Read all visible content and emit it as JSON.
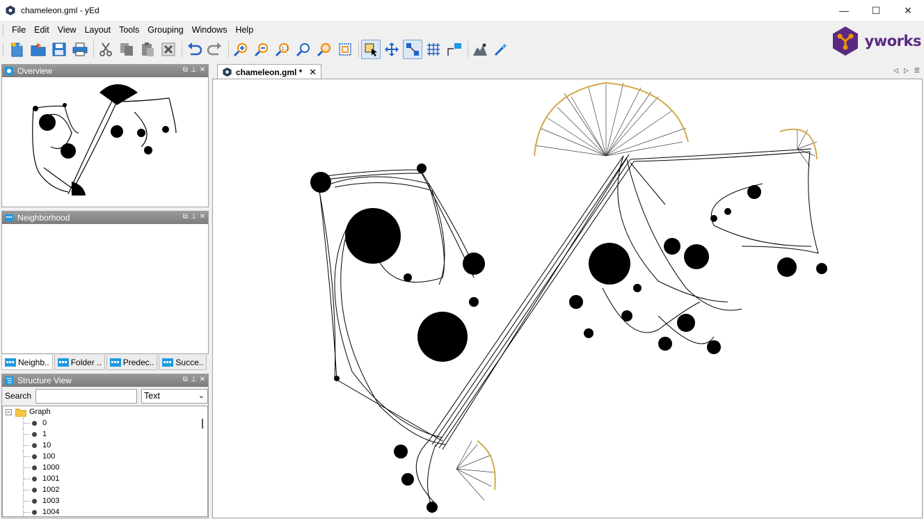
{
  "window": {
    "title": "chameleon.gml - yEd",
    "controls": {
      "minimize": "—",
      "maximize": "☐",
      "close": "✕"
    }
  },
  "menu": [
    "File",
    "Edit",
    "View",
    "Layout",
    "Tools",
    "Grouping",
    "Windows",
    "Help"
  ],
  "brand": {
    "logo_text": "yworks",
    "accent": "#5a2a82",
    "accent2": "#f39200"
  },
  "toolbar": {
    "buttons": [
      "new-document-icon",
      "open-folder-icon",
      "save-icon",
      "print-icon",
      "cut-icon",
      "copy-icon",
      "paste-icon",
      "delete-icon",
      "undo-icon",
      "redo-icon",
      "zoom-in-icon",
      "zoom-out-icon",
      "zoom-original-icon",
      "zoom-icon",
      "zoom-area-icon",
      "fit-content-icon",
      "edit-mode-icon",
      "move-mode-icon",
      "edge-mode-icon",
      "grid-icon",
      "orthogonal-edges-icon",
      "layout-icon",
      "magic-wand-icon"
    ]
  },
  "panels": {
    "overview": {
      "title": "Overview"
    },
    "neighborhood": {
      "title": "Neighborhood"
    },
    "structure": {
      "title": "Structure View",
      "search_label": "Search",
      "search_value": "",
      "filter_value": "Text"
    }
  },
  "side_tabs": [
    "Neighb..",
    "Folder ..",
    "Predec..",
    "Succe.."
  ],
  "tree": {
    "root": "Graph",
    "items": [
      "0",
      "1",
      "10",
      "100",
      "1000",
      "1001",
      "1002",
      "1003",
      "1004"
    ]
  },
  "document": {
    "tab_label": "chameleon.gml *",
    "close": "✕"
  }
}
